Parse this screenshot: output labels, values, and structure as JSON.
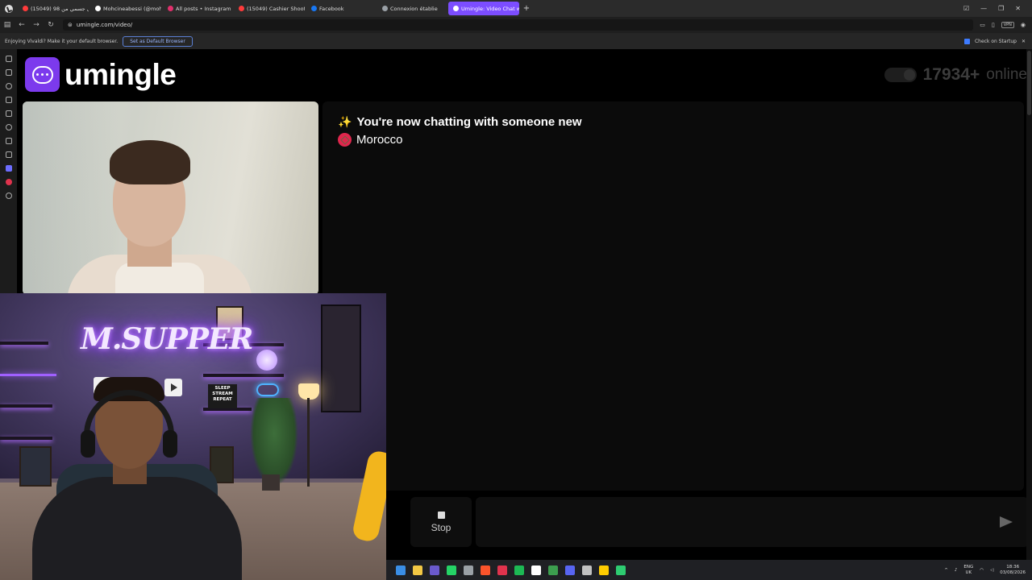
{
  "browser": {
    "tabs": [
      {
        "label": "(15049) 98 تحويل جسمي من",
        "color": "#ff3b3b",
        "active": false
      },
      {
        "label": "Mohcineabessi (@mohcine",
        "color": "#ffffff",
        "active": false
      },
      {
        "label": "All posts • Instagram",
        "color": "#e1306c",
        "active": false
      },
      {
        "label": "(15049) Cashier Shoots for",
        "color": "#ff3b3b",
        "active": false
      },
      {
        "label": "Facebook",
        "color": "#1877f2",
        "active": false
      },
      {
        "label": "Connexion établie",
        "color": "#9aa0a6",
        "active": false
      },
      {
        "label": "Umingle: Video Chat with",
        "color": "#ffffff",
        "active": true
      }
    ],
    "url": "umingle.com/video/",
    "vpn_label": "VPN",
    "notification": {
      "text": "Enjoying Vivaldi? Make it your default browser.",
      "button": "Set as Default Browser",
      "check_label": "Check on Startup"
    }
  },
  "site": {
    "logo_text": "umingle",
    "online_count": "17934+",
    "online_label": "online",
    "chat": {
      "status_emoji": "✨",
      "status_text": "You're now chatting with someone new",
      "country": "Morocco"
    },
    "stop_label": "Stop",
    "message_placeholder": ""
  },
  "webcam": {
    "neon_text": "M.SUPPER",
    "sign_text": "SLEEP STREAM REPEAT"
  },
  "taskbar": {
    "lang_top": "ENG",
    "lang_bottom": "UK",
    "time": "18:36",
    "date": "03/08/2026",
    "apps": [
      "#3a8ee6",
      "#f2c744",
      "#6a5acd",
      "#25d366",
      "#9aa0a6",
      "#fb542b",
      "#e0334d",
      "#1db954",
      "#ffffff",
      "#3c9d4e",
      "#5865f2",
      "#c0c0c0",
      "#ffcc00",
      "#2ecc71"
    ]
  },
  "colors": {
    "brand": "#7c3aed",
    "tab_active": "#7c4dff",
    "flag_red": "#e0264d"
  }
}
